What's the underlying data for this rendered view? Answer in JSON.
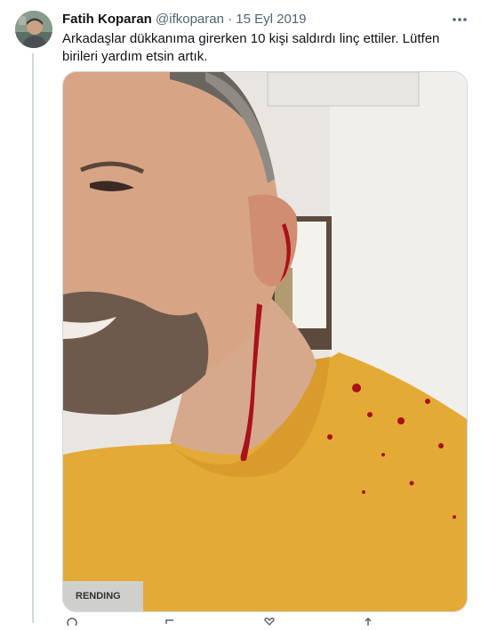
{
  "tweet": {
    "author_name": "Fatih Koparan",
    "handle": "@ifkoparan",
    "separator": "·",
    "date": "15 Eyl 2019",
    "text": "Arkadaşlar dükkanıma girerken 10 kişi saldırdı linç ettiler. Lütfen birileri yardım etsin artık."
  },
  "media": {
    "shirt_print": "RENDING"
  },
  "icons": {
    "more": "more-icon",
    "avatar": "avatar",
    "actions": [
      "reply-icon",
      "retweet-icon",
      "like-icon",
      "share-icon"
    ]
  },
  "colors": {
    "text": "#0f1419",
    "secondary": "#536471",
    "border": "#cfd9de",
    "shirt": "#e4aa36",
    "blood": "#a8121a"
  }
}
